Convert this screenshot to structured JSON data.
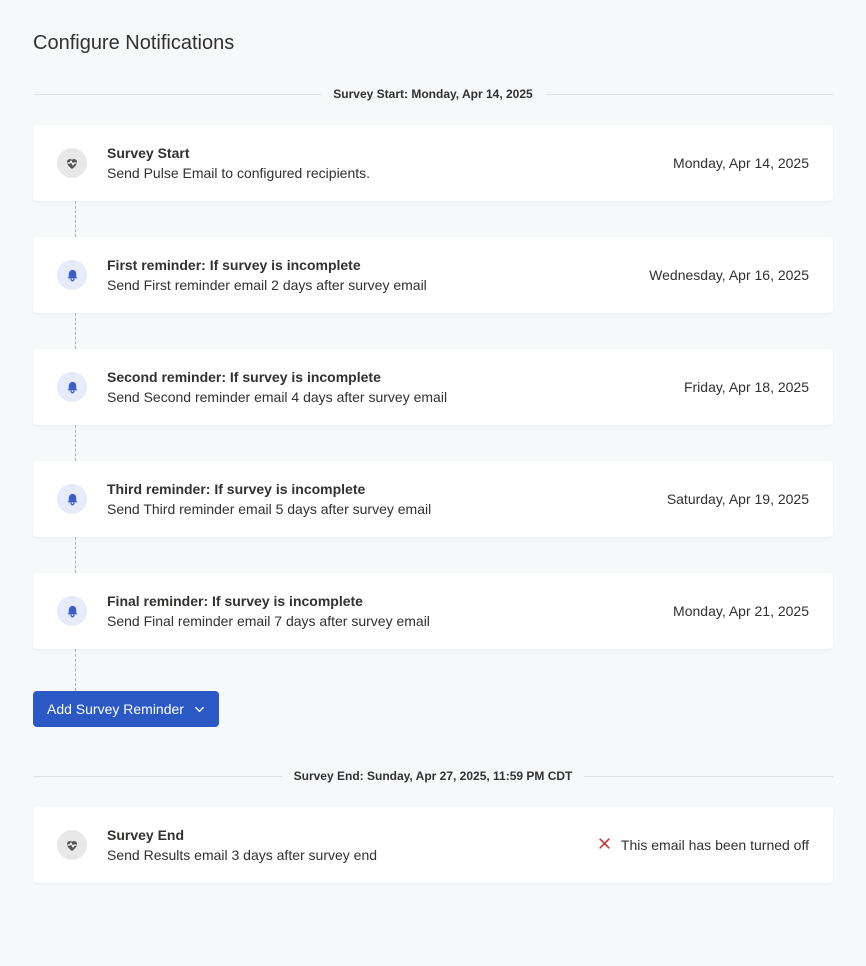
{
  "page_title": "Configure Notifications",
  "start_divider": "Survey Start: Monday, Apr 14, 2025",
  "cards": [
    {
      "icon": "heart",
      "title": "Survey Start",
      "desc": "Send Pulse Email to configured recipients.",
      "date": "Monday, Apr 14, 2025"
    },
    {
      "icon": "bell",
      "title": "First reminder: If survey is incomplete",
      "desc": "Send First reminder email 2 days after survey email",
      "date": "Wednesday, Apr 16, 2025"
    },
    {
      "icon": "bell",
      "title": "Second reminder: If survey is incomplete",
      "desc": "Send Second reminder email 4 days after survey email",
      "date": "Friday, Apr 18, 2025"
    },
    {
      "icon": "bell",
      "title": "Third reminder: If survey is incomplete",
      "desc": "Send Third reminder email 5 days after survey email",
      "date": "Saturday, Apr 19, 2025"
    },
    {
      "icon": "bell",
      "title": "Final reminder: If survey is incomplete",
      "desc": "Send Final reminder email 7 days after survey email",
      "date": "Monday, Apr 21, 2025"
    }
  ],
  "add_button": "Add Survey Reminder",
  "end_divider": "Survey End: Sunday, Apr 27, 2025, 11:59 PM CDT",
  "end_card": {
    "title": "Survey End",
    "desc": "Send Results email 3 days after survey end",
    "off_text": "This email has been turned off"
  }
}
